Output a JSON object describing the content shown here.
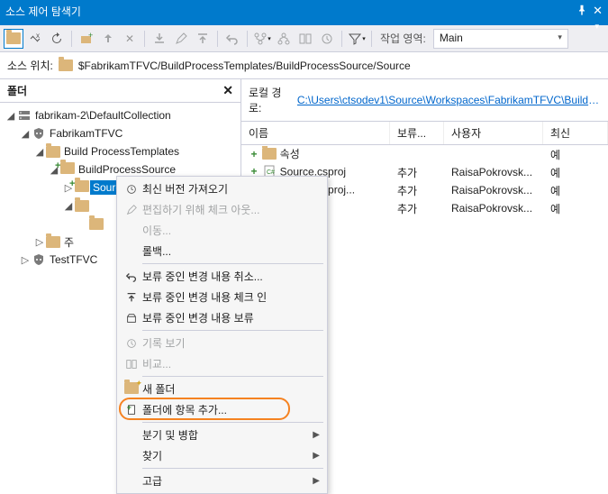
{
  "title": "소스 제어 탐색기",
  "workspace": {
    "label": "작업 영역:",
    "value": "Main"
  },
  "source_location": {
    "label": "소스 위치:",
    "path": "$FabrikamTFVC/BuildProcessTemplates/BuildProcessSource/Source"
  },
  "folders": {
    "header": "폴더",
    "nodes": [
      {
        "label": "fabrikam-2\\DefaultCollection",
        "indent": 0,
        "exp": "◢",
        "ico": "server",
        "sel": false
      },
      {
        "label": "FabrikamTFVC",
        "indent": 1,
        "exp": "◢",
        "ico": "proj",
        "sel": false
      },
      {
        "label": "Build ProcessTemplates",
        "indent": 2,
        "exp": "◢",
        "ico": "folder",
        "sel": false
      },
      {
        "label": "BuildProcessSource",
        "indent": 3,
        "exp": "◢",
        "ico": "folder-plus",
        "sel": false
      },
      {
        "label": "Source",
        "indent": 4,
        "exp": "▷",
        "ico": "folder-plus",
        "sel": true
      },
      {
        "label": "",
        "indent": 4,
        "exp": "◢",
        "ico": "folder",
        "sel": false
      },
      {
        "label": "",
        "indent": 5,
        "exp": "",
        "ico": "folder",
        "sel": false
      },
      {
        "label": "주",
        "indent": 2,
        "exp": "▷",
        "ico": "folder",
        "sel": false
      },
      {
        "label": "TestTFVC",
        "indent": 1,
        "exp": "▷",
        "ico": "proj",
        "sel": false
      }
    ]
  },
  "details": {
    "local_label": "로컬 경로:",
    "local_path": "C:\\Users\\ctsodev1\\Source\\Workspaces\\FabrikamTFVC\\BuildProc...",
    "columns": {
      "name": "이름",
      "pending": "보류...",
      "user": "사용자",
      "latest": "최신"
    },
    "rows": [
      {
        "plus": true,
        "ico": "folder",
        "name": "속성",
        "pending": "",
        "user": "",
        "latest": "예"
      },
      {
        "plus": true,
        "ico": "cs",
        "name": "Source.csproj",
        "pending": "추가",
        "user": "RaisaPokrovsk...",
        "latest": "예"
      },
      {
        "plus": true,
        "ico": "cs",
        "name": "Source.csproj...",
        "pending": "추가",
        "user": "RaisaPokrovsk...",
        "latest": "예"
      },
      {
        "plus": true,
        "ico": "",
        "name": "",
        "pending": "추가",
        "user": "RaisaPokrovsk...",
        "latest": "예"
      }
    ]
  },
  "context_menu": [
    {
      "type": "item",
      "ico": "refresh",
      "label": "최신 버전 가져오기",
      "disabled": false
    },
    {
      "type": "item",
      "ico": "checkout",
      "label": "편집하기 위해 체크 아웃...",
      "disabled": true
    },
    {
      "type": "item",
      "ico": "",
      "label": "이동...",
      "disabled": true
    },
    {
      "type": "item",
      "ico": "",
      "label": "롤백...",
      "disabled": false
    },
    {
      "type": "sep"
    },
    {
      "type": "item",
      "ico": "undo",
      "label": "보류 중인 변경 내용 취소...",
      "disabled": false
    },
    {
      "type": "item",
      "ico": "checkin",
      "label": "보류 중인 변경 내용 체크 인",
      "disabled": false
    },
    {
      "type": "item",
      "ico": "shelve",
      "label": "보류 중인 변경 내용 보류",
      "disabled": false
    },
    {
      "type": "sep"
    },
    {
      "type": "item",
      "ico": "history",
      "label": "기록 보기",
      "disabled": true
    },
    {
      "type": "item",
      "ico": "compare",
      "label": "비교...",
      "disabled": true
    },
    {
      "type": "sep"
    },
    {
      "type": "item",
      "ico": "newfolder",
      "label": "새 폴더",
      "disabled": false
    },
    {
      "type": "item",
      "ico": "additem",
      "label": "폴더에 항목 추가...",
      "disabled": false,
      "highlight": true
    },
    {
      "type": "sep"
    },
    {
      "type": "item",
      "ico": "",
      "label": "분기 및 병합",
      "disabled": false,
      "submenu": true
    },
    {
      "type": "item",
      "ico": "",
      "label": "찾기",
      "disabled": false,
      "submenu": true
    },
    {
      "type": "sep"
    },
    {
      "type": "item",
      "ico": "",
      "label": "고급",
      "disabled": false,
      "submenu": true
    }
  ]
}
